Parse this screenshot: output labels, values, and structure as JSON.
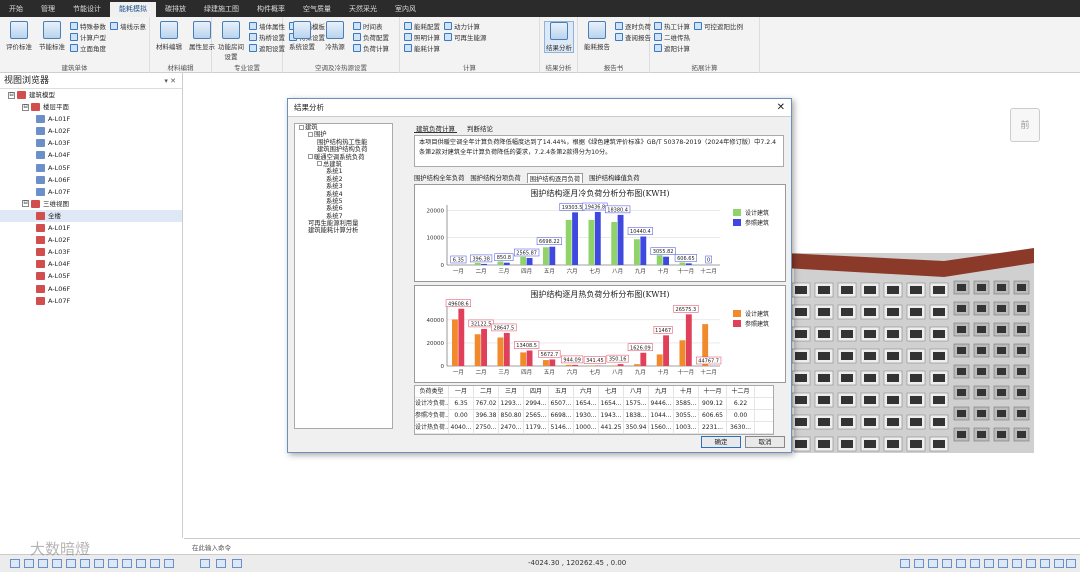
{
  "menu": [
    "开始",
    "管理",
    "节能设计",
    "能耗模拟",
    "碳排放",
    "绿建施工图",
    "构件概率",
    "空气质量",
    "天然采光",
    "室内风"
  ],
  "ribbon": {
    "groups": [
      {
        "label": "建筑单体",
        "big": [
          {
            "label": "评价标准"
          },
          {
            "label": "节能标准"
          }
        ],
        "small": [
          "特殊参数",
          "计算户型",
          "立面角度",
          "墙线示意"
        ]
      },
      {
        "label": "材料编辑",
        "big": [
          {
            "label": "材料编辑"
          },
          {
            "label": "属性显示"
          }
        ],
        "small": []
      },
      {
        "label": "专业设置",
        "big": [
          {
            "label": "功能房间设置"
          }
        ],
        "small": [
          "墙体属性",
          "热桥设置",
          "遮阳设置",
          "隔墙模板",
          "特殊设置"
        ]
      },
      {
        "label": "空调及冷热源设置",
        "big": [
          {
            "label": "系统设置"
          },
          {
            "label": "冷热源"
          }
        ],
        "small": [
          "时间表",
          "负荷配置",
          "负荷计算"
        ]
      },
      {
        "label": "计算",
        "big": [],
        "small": [
          "能耗配置",
          "照明计算",
          "能耗计算",
          "动力计算",
          "可再生能源"
        ]
      },
      {
        "label": "结果分析",
        "big": [
          {
            "label": "结果分析"
          }
        ],
        "small": []
      },
      {
        "label": "报告书",
        "big": [
          {
            "label": "能耗报告"
          }
        ],
        "small": [
          "逐时负荷",
          "查阅报告"
        ]
      },
      {
        "label": "拓展计算",
        "big": [],
        "small": [
          "热工计算",
          "二维传热",
          "遮阳计算",
          "可控遮阳比例"
        ]
      }
    ]
  },
  "sidebar": {
    "title": "视图浏览器",
    "pin": "▾ ✕",
    "items": [
      {
        "label": "建筑模型",
        "level": 0,
        "tog": "⊟",
        "icon": "r"
      },
      {
        "label": "楼层平面",
        "level": 1,
        "tog": "⊟",
        "icon": "r"
      },
      {
        "label": "A-L01F",
        "level": 2,
        "icon": "b"
      },
      {
        "label": "A-L02F",
        "level": 2,
        "icon": "b"
      },
      {
        "label": "A-L03F",
        "level": 2,
        "icon": "b"
      },
      {
        "label": "A-L04F",
        "level": 2,
        "icon": "b"
      },
      {
        "label": "A-L05F",
        "level": 2,
        "icon": "b"
      },
      {
        "label": "A-L06F",
        "level": 2,
        "icon": "b"
      },
      {
        "label": "A-L07F",
        "level": 2,
        "icon": "b"
      },
      {
        "label": "三维视图",
        "level": 1,
        "tog": "⊟",
        "icon": "r"
      },
      {
        "label": "全楼",
        "level": 2,
        "icon": "r",
        "sel": true
      },
      {
        "label": "A-L01F",
        "level": 2,
        "icon": "r"
      },
      {
        "label": "A-L02F",
        "level": 2,
        "icon": "r"
      },
      {
        "label": "A-L03F",
        "level": 2,
        "icon": "r"
      },
      {
        "label": "A-L04F",
        "level": 2,
        "icon": "r"
      },
      {
        "label": "A-L05F",
        "level": 2,
        "icon": "r"
      },
      {
        "label": "A-L06F",
        "level": 2,
        "icon": "r"
      },
      {
        "label": "A-L07F",
        "level": 2,
        "icon": "r"
      }
    ]
  },
  "viewport": {
    "cube_label": "前"
  },
  "cmd": {
    "placeholder": "在此输入命令"
  },
  "status": {
    "coords": "-4024.30 , 120262.45 , 0.00"
  },
  "watermark": "大数暗燈",
  "dialog": {
    "title": "结果分析",
    "close": "✕",
    "tree": [
      {
        "label": "建筑",
        "level": 0,
        "tog": true
      },
      {
        "label": "围护",
        "level": 1,
        "tog": true
      },
      {
        "label": "围护结构热工性能",
        "level": 2
      },
      {
        "label": "建筑围护结构负荷",
        "level": 2
      },
      {
        "label": "暖通空调系统负荷",
        "level": 1,
        "tog": true
      },
      {
        "label": "总建筑",
        "level": 2,
        "tog": true
      },
      {
        "label": "系统1",
        "level": 3
      },
      {
        "label": "系统2",
        "level": 3
      },
      {
        "label": "系统3",
        "level": 3
      },
      {
        "label": "系统4",
        "level": 3
      },
      {
        "label": "系统5",
        "level": 3
      },
      {
        "label": "系统6",
        "level": 3
      },
      {
        "label": "系统7",
        "level": 3
      },
      {
        "label": "可再生能源利用量",
        "level": 1
      },
      {
        "label": "建筑能耗计算分析",
        "level": 1
      }
    ],
    "tabs1": [
      "建筑负荷计算",
      "判断结论"
    ],
    "conclusion": "本项目供暖空调全年计算负荷降低幅度达到了14.44%，根据《绿色建筑评价标准》GB/T 50378-2019（2024年修订版）中7.2.4条第2款对建筑全年计算负荷降低的要求，7.2.4条第2款得分为10分。",
    "tabs2": [
      "围护结构全年负荷",
      "围护结构分项负荷",
      "围护结构逐月负荷",
      "围护结构峰值负荷"
    ],
    "active_tab2": 2,
    "table": {
      "headers": [
        "负荷类型",
        "一月",
        "二月",
        "三月",
        "四月",
        "五月",
        "六月",
        "七月",
        "八月",
        "九月",
        "十月",
        "十一月",
        "十二月"
      ],
      "rows": [
        [
          "设计冷负荷...",
          "6.35",
          "767.02",
          "1293...",
          "2994...",
          "6507...",
          "1654...",
          "1654...",
          "1575...",
          "9446...",
          "3585...",
          "909.12",
          "6.22"
        ],
        [
          "参照冷负荷...",
          "0.00",
          "396.38",
          "850.80",
          "2565...",
          "6698...",
          "1930...",
          "1943...",
          "1838...",
          "1044...",
          "3055...",
          "606.65",
          "0.00"
        ],
        [
          "设计热负荷...",
          "4040...",
          "2750...",
          "2470...",
          "1179...",
          "5146...",
          "1000...",
          "441.25",
          "350.94",
          "1560...",
          "1003...",
          "2231...",
          "3630..."
        ]
      ]
    },
    "ok": "确定",
    "cancel": "取消"
  },
  "chart_data": [
    {
      "type": "bar",
      "title": "围护结构逐月冷负荷分析分布图(KWH)",
      "categories": [
        "一月",
        "二月",
        "三月",
        "四月",
        "五月",
        "六月",
        "七月",
        "八月",
        "九月",
        "十月",
        "十一月",
        "十二月"
      ],
      "series": [
        {
          "name": "设计建筑",
          "color": "#8fd36a",
          "values": [
            6.35,
            767.02,
            1293,
            2994,
            6507,
            16540,
            16540,
            15750,
            9446,
            3585,
            909.12,
            6.22
          ]
        },
        {
          "name": "参照建筑",
          "color": "#3f49e0",
          "values": [
            0,
            396.38,
            850.8,
            2565.87,
            6698.22,
            19303,
            19436,
            18380.4,
            10440.4,
            3055.82,
            606.65,
            0
          ]
        }
      ],
      "ylim": [
        0,
        22000
      ],
      "yticks": [
        0,
        10000,
        20000
      ],
      "labels": [
        {
          "i": 0,
          "s": 0,
          "t": "6.35"
        },
        {
          "i": 1,
          "s": 1,
          "t": "396.38"
        },
        {
          "i": 2,
          "s": 1,
          "t": "850.8"
        },
        {
          "i": 3,
          "s": 1,
          "t": "2565.87"
        },
        {
          "i": 4,
          "s": 1,
          "t": "6698.22"
        },
        {
          "i": 5,
          "s": 1,
          "t": "19303.5"
        },
        {
          "i": 6,
          "s": 1,
          "t": "19436.8"
        },
        {
          "i": 7,
          "s": 1,
          "t": "18380.4"
        },
        {
          "i": 8,
          "s": 1,
          "t": "10440.4"
        },
        {
          "i": 9,
          "s": 1,
          "t": "3055.82"
        },
        {
          "i": 10,
          "s": 1,
          "t": "606.65"
        },
        {
          "i": 11,
          "s": 1,
          "t": "0"
        }
      ]
    },
    {
      "type": "bar",
      "title": "围护结构逐月热负荷分析分布图(KWH)",
      "categories": [
        "一月",
        "二月",
        "三月",
        "四月",
        "五月",
        "六月",
        "七月",
        "八月",
        "九月",
        "十月",
        "十一月",
        "十二月"
      ],
      "series": [
        {
          "name": "设计建筑",
          "color": "#f08a2c",
          "values": [
            40400,
            27500,
            24700,
            11790,
            5146,
            1000,
            441.25,
            350.94,
            1560,
            10030,
            22310,
            36300
          ]
        },
        {
          "name": "参照建筑",
          "color": "#e0405a",
          "values": [
            49608.6,
            32122.5,
            28647.5,
            13408.5,
            5672.7,
            944.09,
            341.45,
            1626.09,
            11467,
            26575.3,
            44767.7,
            0
          ]
        }
      ],
      "ylim": [
        0,
        52000
      ],
      "yticks": [
        0,
        20000,
        40000
      ],
      "labels": [
        {
          "i": 0,
          "s": 1,
          "t": "49608.6"
        },
        {
          "i": 1,
          "s": 1,
          "t": "32122.5"
        },
        {
          "i": 2,
          "s": 1,
          "t": "28647.5"
        },
        {
          "i": 3,
          "s": 1,
          "t": "13408.5"
        },
        {
          "i": 4,
          "s": 1,
          "t": "5672.7"
        },
        {
          "i": 5,
          "s": 1,
          "t": "944.09"
        },
        {
          "i": 6,
          "s": 1,
          "t": "341.45"
        },
        {
          "i": 7,
          "s": 1,
          "t": "350.16"
        },
        {
          "i": 8,
          "s": 1,
          "t": "1626.09"
        },
        {
          "i": 9,
          "s": 1,
          "t": "11467"
        },
        {
          "i": 10,
          "s": 1,
          "t": "26575.3"
        },
        {
          "i": 11,
          "s": 1,
          "t": "44767.7"
        }
      ]
    }
  ]
}
